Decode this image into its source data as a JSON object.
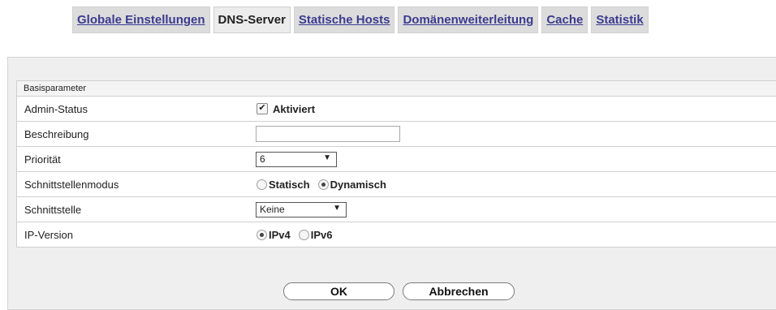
{
  "tabs": [
    {
      "label": "Globale Einstellungen",
      "active": false
    },
    {
      "label": "DNS-Server",
      "active": true
    },
    {
      "label": "Statische Hosts",
      "active": false
    },
    {
      "label": "Domänenweiterleitung",
      "active": false
    },
    {
      "label": "Cache",
      "active": false
    },
    {
      "label": "Statistik",
      "active": false
    }
  ],
  "section": {
    "title": "Basisparameter",
    "rows": {
      "admin_status": {
        "label": "Admin-Status",
        "checkbox_label": "Aktiviert",
        "checked": true
      },
      "description": {
        "label": "Beschreibung",
        "value": ""
      },
      "priority": {
        "label": "Priorität",
        "value": "6"
      },
      "interface_mode": {
        "label": "Schnittstellenmodus",
        "options": [
          "Statisch",
          "Dynamisch"
        ],
        "selected": "Dynamisch"
      },
      "interface": {
        "label": "Schnittstelle",
        "value": "Keine"
      },
      "ip_version": {
        "label": "IP-Version",
        "options": [
          "IPv4",
          "IPv6"
        ],
        "selected": "IPv4"
      }
    }
  },
  "buttons": {
    "ok": "OK",
    "cancel": "Abbrechen"
  },
  "icons": {
    "checkbox_check": "✔",
    "dropdown_arrow": "▼"
  }
}
